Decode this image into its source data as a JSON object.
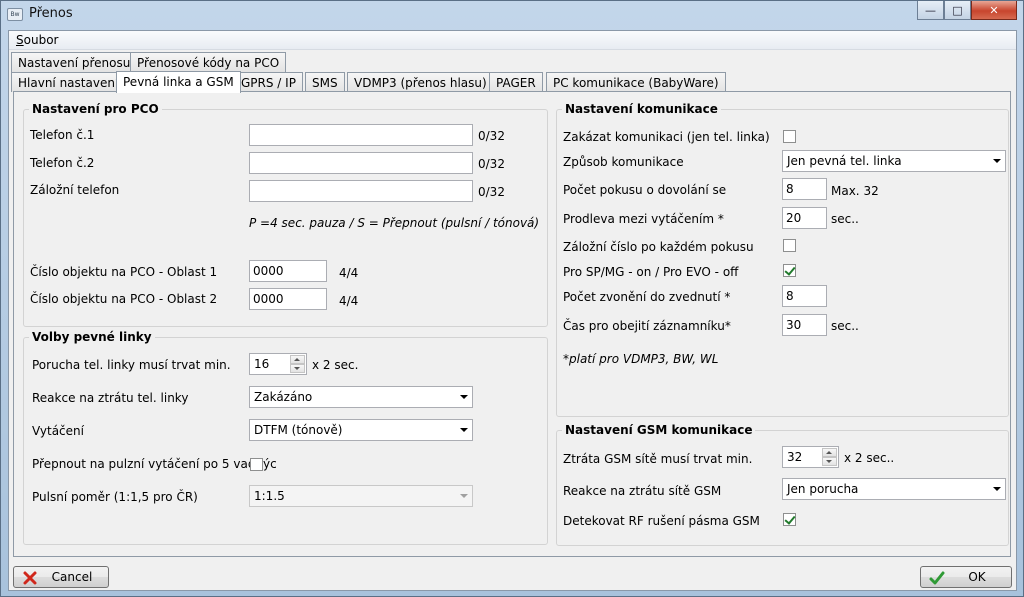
{
  "window": {
    "title": "Přenos",
    "icon_text": "Bw"
  },
  "menu": {
    "file_accel": "S",
    "file_rest": "oubor"
  },
  "tabs_top": [
    "Nastavení přenosu",
    "Přenosové kódy na PCO"
  ],
  "tabs_bottom": [
    "Hlavní nastavení",
    "Pevná linka a GSM",
    "GPRS / IP",
    "SMS",
    "VDMP3 (přenos hlasu)",
    "PAGER",
    "PC komunikace (BabyWare)"
  ],
  "pco": {
    "title": "Nastavení pro PCO",
    "phone1_label": "Telefon č.1",
    "phone1_value": "",
    "phone1_count": "0/32",
    "phone2_label": "Telefon č.2",
    "phone2_value": "",
    "phone2_count": "0/32",
    "backup_label": "Záložní telefon",
    "backup_value": "",
    "backup_count": "0/32",
    "hint": "P =4 sec. pauza / S = Přepnout (pulsní / tónová)",
    "obj1_label": "Číslo objektu na PCO - Oblast 1",
    "obj1_value": "0000",
    "obj1_count": "4/4",
    "obj2_label": "Číslo objektu na PCO - Oblast 2",
    "obj2_value": "0000",
    "obj2_count": "4/4"
  },
  "landline": {
    "title": "Volby pevné linky",
    "fault_label": "Porucha tel. linky musí trvat min.",
    "fault_value": "16",
    "fault_unit": "x 2 sec.",
    "reaction_label": "Reakce na ztrátu tel. linky",
    "reaction_value": "Zakázáno",
    "dial_label": "Vytáčení",
    "dial_value": "DTFM (tónově)",
    "pulse_switch_label": "Přepnout na pulzní vytáčení po 5 vadnýc",
    "pulse_switch_checked": false,
    "pulse_ratio_label": "Pulsní poměr (1:1,5 pro ČR)",
    "pulse_ratio_value": "1:1.5"
  },
  "comm": {
    "title": "Nastavení komunikace",
    "disable_label": "Zakázat komunikaci (jen tel. linka)",
    "disable_checked": false,
    "mode_label": "Způsob komunikace",
    "mode_value": "Jen pevná tel. linka",
    "attempts_label": "Počet pokusu o dovolání se",
    "attempts_value": "8",
    "attempts_max": "Max. 32",
    "delay_label": "Prodleva mezi vytáčením *",
    "delay_value": "20",
    "delay_unit": "sec..",
    "backup_each_label": "Záložní číslo po každém pokusu",
    "backup_each_checked": false,
    "sp_label": "Pro SP/MG - on / Pro EVO - off",
    "sp_checked": true,
    "rings_label": "Počet zvonění do zvednutí *",
    "rings_value": "8",
    "bypass_label": "Čas pro obejití záznamníku*",
    "bypass_value": "30",
    "bypass_unit": "sec..",
    "note": "*platí pro VDMP3, BW, WL"
  },
  "gsm": {
    "title": "Nastavení GSM komunikace",
    "loss_label": "Ztráta GSM sítě musí trvat min.",
    "loss_value": "32",
    "loss_unit": "x 2 sec..",
    "reaction_label": "Reakce na ztrátu sítě GSM",
    "reaction_value": "Jen porucha",
    "rf_label": "Detekovat RF rušení pásma GSM",
    "rf_checked": true
  },
  "buttons": {
    "cancel": "Cancel",
    "ok": "OK"
  },
  "colors": {
    "cancel_icon": "#d0281c",
    "ok_icon": "#2f9a35"
  }
}
